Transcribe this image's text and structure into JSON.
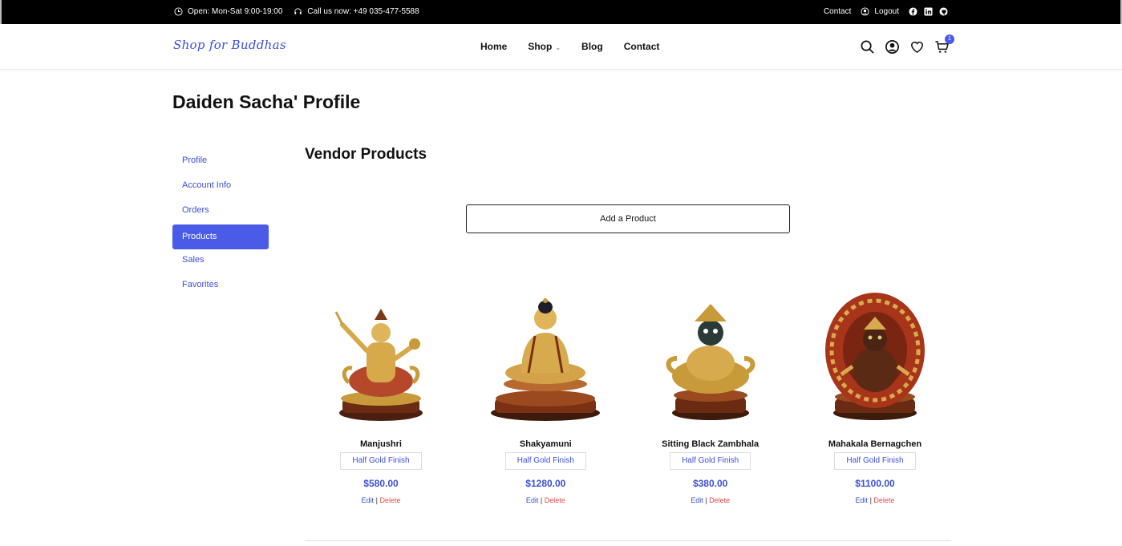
{
  "topbar": {
    "hours": "Open: Mon-Sat 9:00-19:00",
    "phone": "Call us now: +49 035-477-5588",
    "contact": "Contact",
    "logout": "Logout",
    "social_icons": [
      "facebook-icon",
      "linkedin-icon",
      "github-icon"
    ]
  },
  "nav": {
    "logo": "Shop for Buddhas",
    "menu": [
      "Home",
      "Shop",
      "Blog",
      "Contact"
    ],
    "cart_count": "1",
    "accent": "#4a5be8"
  },
  "page": {
    "title": "Daiden Sacha' Profile"
  },
  "sidebar": {
    "items": [
      "Profile",
      "Account Info",
      "Orders",
      "Products",
      "Sales",
      "Favorites"
    ],
    "active": "Products"
  },
  "main": {
    "section_title": "Vendor Products",
    "add_button": "Add a Product",
    "products": [
      {
        "name": "Manjushri",
        "variant": "Half Gold Finish",
        "price": "$580.00",
        "edit": "Edit",
        "separator": "|",
        "delete": "Delete"
      },
      {
        "name": "Shakyamuni",
        "variant": "Half Gold Finish",
        "price": "$1280.00",
        "edit": "Edit",
        "separator": "|",
        "delete": "Delete"
      },
      {
        "name": "Sitting Black Zambhala",
        "variant": "Half Gold Finish",
        "price": "$380.00",
        "edit": "Edit",
        "separator": "|",
        "delete": "Delete"
      },
      {
        "name": "Mahakala Bernagchen",
        "variant": "Half Gold Finish",
        "price": "$1100.00",
        "edit": "Edit",
        "separator": "|",
        "delete": "Delete"
      }
    ]
  }
}
